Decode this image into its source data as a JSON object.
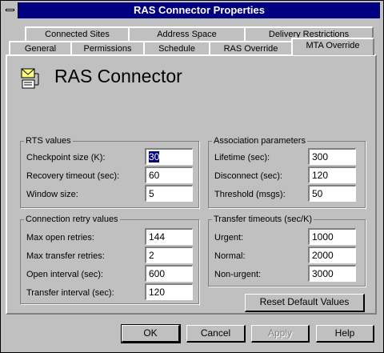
{
  "window": {
    "title": "RAS Connector Properties"
  },
  "tabs_back": [
    "Connected Sites",
    "Address Space",
    "Delivery Restrictions"
  ],
  "tabs_front": [
    "General",
    "Permissions",
    "Schedule",
    "RAS Override",
    "MTA Override"
  ],
  "header": {
    "title": "RAS Connector",
    "icon": "connector-icon"
  },
  "rts": {
    "title": "RTS values",
    "checkpoint_label": "Checkpoint size (K):",
    "checkpoint_value": "30",
    "recovery_label": "Recovery timeout (sec):",
    "recovery_value": "60",
    "window_label": "Window size:",
    "window_value": "5"
  },
  "assoc": {
    "title": "Association parameters",
    "lifetime_label": "Lifetime (sec):",
    "lifetime_value": "300",
    "disconnect_label": "Disconnect (sec):",
    "disconnect_value": "120",
    "threshold_label": "Threshold (msgs):",
    "threshold_value": "50"
  },
  "retry": {
    "title": "Connection retry values",
    "open_retries_label": "Max open retries:",
    "open_retries_value": "144",
    "transfer_retries_label": "Max transfer retries:",
    "transfer_retries_value": "2",
    "open_interval_label": "Open interval (sec):",
    "open_interval_value": "600",
    "transfer_interval_label": "Transfer interval (sec):",
    "transfer_interval_value": "120"
  },
  "timeouts": {
    "title": "Transfer timeouts (sec/K)",
    "urgent_label": "Urgent:",
    "urgent_value": "1000",
    "normal_label": "Normal:",
    "normal_value": "2000",
    "nonurgent_label": "Non-urgent:",
    "nonurgent_value": "3000"
  },
  "buttons": {
    "reset": "Reset Default Values",
    "ok": "OK",
    "cancel": "Cancel",
    "apply": "Apply",
    "help": "Help"
  },
  "colors": {
    "titlebar": "#000080",
    "face": "#c0c0c0"
  }
}
